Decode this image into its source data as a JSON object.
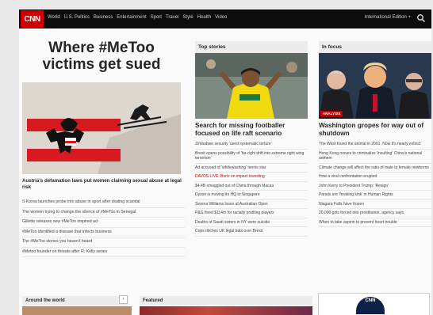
{
  "nav": {
    "logo": "CNN",
    "links": [
      "World",
      "U.S. Politics",
      "Business",
      "Entertainment",
      "Sport",
      "Travel",
      "Style",
      "Health",
      "Video"
    ],
    "edition": "International Edition +",
    "search_icon": "search-icon"
  },
  "col1": {
    "headline": "Where #MeToo victims get sued",
    "lead_story": "Austria's defamation laws put women claiming sexual abuse at legal risk",
    "items": [
      "S Korea launches probe into abuse in sport after skating scandal",
      "The women trying to change the silence of #MeToo in Senegal",
      "Gillette releases new #MeToo inspired ad",
      "#MeToo identified a disease that infects business",
      "The #MeToo stories you haven't heard",
      "#Metoo founder on threats after R. Kelly series"
    ]
  },
  "col2": {
    "header": "Top stories",
    "story": "Search for missing footballer focused on life raft scenario",
    "items": [
      {
        "text": "Zimbabwe security 'used systematic torture'",
        "live": false
      },
      {
        "text": "Brexit opens possibility of 'far-right drift into extreme right wing terrorism'",
        "live": false
      },
      {
        "text": "Ad accused of 'whitewashing' tennis star",
        "live": false
      },
      {
        "text": "DAVOS LIVE: Boris on impact investing",
        "live": true
      },
      {
        "text": "$4.4B smuggled out of China through Macau",
        "live": false
      },
      {
        "text": "Dyson is moving its HQ to Singapore",
        "live": false
      },
      {
        "text": "Serena Williams loses at Australian Open",
        "live": false
      },
      {
        "text": "P&G fined $114m for racially profiling players",
        "live": false
      },
      {
        "text": "Deaths of Saudi sisters in NY were suicide",
        "live": false
      },
      {
        "text": "Cops ditches UK legal bats over Brexit",
        "live": false
      }
    ]
  },
  "col3": {
    "header": "In focus",
    "badge": "ANALYSIS",
    "story": "Washington gropes for way out of shutdown",
    "items": [
      "The West found the animal in 2001. Now it's nearly extinct",
      "Hong Kong moves to criminalize 'insulting' China's national anthem",
      "Climate change will affect the ratio of male to female newborns",
      "How a viral confrontation erupted",
      "John Kerry to President Trump: 'Resign'",
      "Panels are 'freaking kink' in Human Rights",
      "Niagara Falls have frozen",
      "20,000 girls forced into prostitution, agency says",
      "When to take aspirin to prevent heart trouble"
    ]
  },
  "bottom": {
    "around": "Around the world",
    "featured": "Featured",
    "ad_text": "CNN"
  },
  "colors": {
    "brand_red": "#cc0000",
    "nav_bg": "#0c0c0c"
  }
}
